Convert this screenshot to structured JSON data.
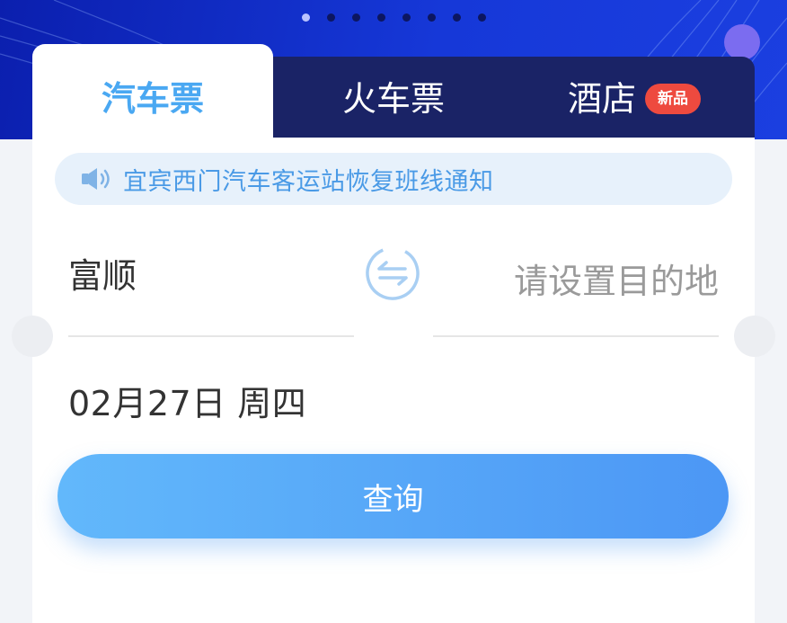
{
  "carousel": {
    "dot_count": 8,
    "active_index": 0
  },
  "tabs": [
    {
      "label": "汽车票",
      "active": true
    },
    {
      "label": "火车票",
      "active": false
    },
    {
      "label": "酒店",
      "active": false,
      "badge": "新品"
    }
  ],
  "notice": {
    "icon": "speaker-icon",
    "text": "宜宾西门汽车客运站恢复班线通知"
  },
  "route": {
    "from": "富顺",
    "to_placeholder": "请设置目的地",
    "swap_icon": "swap-icon"
  },
  "date": {
    "value": "02月27日 周四"
  },
  "search_button": {
    "label": "查询"
  },
  "colors": {
    "accent": "#4aa8f2",
    "banner": "#1638d8",
    "badge": "#ee4a3f",
    "button_start": "#62b8fb",
    "button_end": "#4c97f5"
  }
}
